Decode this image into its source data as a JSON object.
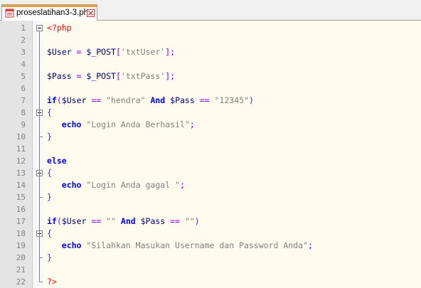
{
  "tab": {
    "title": "proseslatihan3-3.php"
  },
  "lines": [
    {
      "n": "1",
      "tokens": [
        {
          "t": "<?php",
          "c": "php"
        }
      ]
    },
    {
      "n": "2",
      "tokens": []
    },
    {
      "n": "3",
      "tokens": [
        {
          "t": "$User",
          "c": "var"
        },
        {
          "t": " = ",
          "c": "op"
        },
        {
          "t": "$_POST",
          "c": "var"
        },
        {
          "t": "[",
          "c": "op"
        },
        {
          "t": "'txtUser'",
          "c": "str"
        },
        {
          "t": "];",
          "c": "op"
        }
      ]
    },
    {
      "n": "4",
      "tokens": []
    },
    {
      "n": "5",
      "tokens": [
        {
          "t": "$Pass",
          "c": "var"
        },
        {
          "t": " = ",
          "c": "op"
        },
        {
          "t": "$_POST",
          "c": "var"
        },
        {
          "t": "[",
          "c": "op"
        },
        {
          "t": "'txtPass'",
          "c": "str"
        },
        {
          "t": "];",
          "c": "op"
        }
      ]
    },
    {
      "n": "6",
      "tokens": []
    },
    {
      "n": "7",
      "tokens": [
        {
          "t": "if",
          "c": "kw"
        },
        {
          "t": "(",
          "c": "op"
        },
        {
          "t": "$User",
          "c": "var"
        },
        {
          "t": " == ",
          "c": "op"
        },
        {
          "t": "\"hendra\"",
          "c": "str"
        },
        {
          "t": " And ",
          "c": "kw"
        },
        {
          "t": "$Pass",
          "c": "var"
        },
        {
          "t": " == ",
          "c": "op"
        },
        {
          "t": "\"12345\"",
          "c": "str"
        },
        {
          "t": ")",
          "c": "op"
        }
      ]
    },
    {
      "n": "8",
      "tokens": [
        {
          "t": "{",
          "c": "op"
        }
      ]
    },
    {
      "n": "9",
      "tokens": [
        {
          "t": "   echo",
          "c": "kw"
        },
        {
          "t": " ",
          "c": "plain"
        },
        {
          "t": "\"Login Anda Berhasil\"",
          "c": "str"
        },
        {
          "t": ";",
          "c": "op"
        }
      ]
    },
    {
      "n": "10",
      "tokens": [
        {
          "t": "}",
          "c": "op"
        }
      ]
    },
    {
      "n": "11",
      "tokens": []
    },
    {
      "n": "12",
      "tokens": [
        {
          "t": "else",
          "c": "kw"
        }
      ]
    },
    {
      "n": "13",
      "tokens": [
        {
          "t": "{",
          "c": "op"
        }
      ]
    },
    {
      "n": "14",
      "tokens": [
        {
          "t": "   echo",
          "c": "kw"
        },
        {
          "t": " ",
          "c": "plain"
        },
        {
          "t": "\"Login Anda gagal \"",
          "c": "str"
        },
        {
          "t": ";",
          "c": "op"
        }
      ]
    },
    {
      "n": "15",
      "tokens": [
        {
          "t": "}",
          "c": "op"
        }
      ]
    },
    {
      "n": "16",
      "tokens": []
    },
    {
      "n": "17",
      "tokens": [
        {
          "t": "if",
          "c": "kw"
        },
        {
          "t": "(",
          "c": "op"
        },
        {
          "t": "$User",
          "c": "var"
        },
        {
          "t": " == ",
          "c": "op"
        },
        {
          "t": "\"\"",
          "c": "str"
        },
        {
          "t": " And ",
          "c": "kw"
        },
        {
          "t": "$Pass",
          "c": "var"
        },
        {
          "t": " == ",
          "c": "op"
        },
        {
          "t": "\"\"",
          "c": "str"
        },
        {
          "t": ")",
          "c": "op"
        }
      ]
    },
    {
      "n": "18",
      "tokens": [
        {
          "t": "{",
          "c": "op"
        }
      ]
    },
    {
      "n": "19",
      "tokens": [
        {
          "t": "   echo",
          "c": "kw"
        },
        {
          "t": " ",
          "c": "plain"
        },
        {
          "t": "\"Silahkan Masukan Username dan Password Anda\"",
          "c": "str"
        },
        {
          "t": ";",
          "c": "op"
        }
      ]
    },
    {
      "n": "20",
      "tokens": [
        {
          "t": "}",
          "c": "op"
        }
      ]
    },
    {
      "n": "21",
      "tokens": []
    },
    {
      "n": "22",
      "tokens": [
        {
          "t": "?>",
          "c": "php"
        }
      ]
    }
  ]
}
